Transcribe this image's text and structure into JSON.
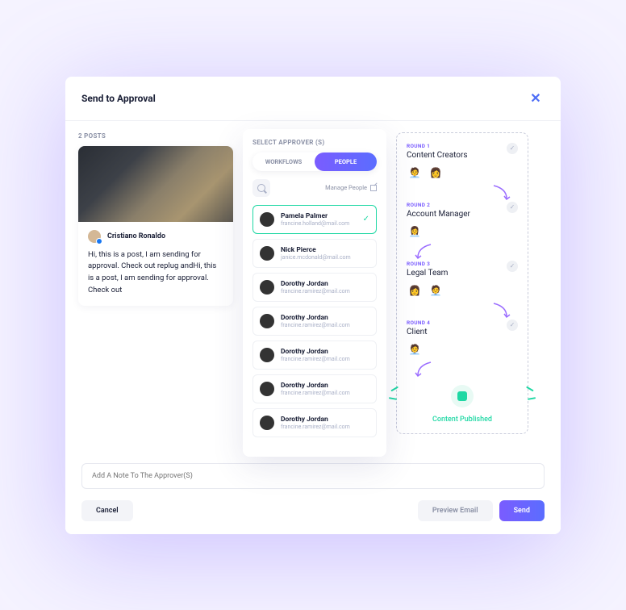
{
  "header": {
    "title": "Send to Approval"
  },
  "posts": {
    "count_label": "2 POSTS",
    "author": "Cristiano Ronaldo",
    "text": "Hi, this is a post, I am sending for approval. Check out replug andHi, this is a post, I am sending for approval. Check out"
  },
  "approvers": {
    "section_label": "SELECT APPROVER (s)",
    "tabs": {
      "workflows": "WORKFLOWS",
      "people": "PEOPLE"
    },
    "manage_label": "Manage People",
    "people": [
      {
        "name": "Pamela Palmer",
        "email": "francine.holland@mail.com",
        "selected": true
      },
      {
        "name": "Nick Pierce",
        "email": "janice.mcdonald@mail.com",
        "selected": false
      },
      {
        "name": "Dorothy Jordan",
        "email": "francine.ramirez@mail.com",
        "selected": false
      },
      {
        "name": "Dorothy Jordan",
        "email": "francine.ramirez@mail.com",
        "selected": false
      },
      {
        "name": "Dorothy Jordan",
        "email": "francine.ramirez@mail.com",
        "selected": false
      },
      {
        "name": "Dorothy Jordan",
        "email": "francine.ramirez@mail.com",
        "selected": false
      },
      {
        "name": "Dorothy Jordan",
        "email": "francine.ramirez@mail.com",
        "selected": false
      }
    ]
  },
  "flow": {
    "rounds": [
      {
        "label": "ROUND 1",
        "title": "Content Creators",
        "avatars": [
          "🧑‍💼",
          "👩"
        ]
      },
      {
        "label": "ROUND 2",
        "title": "Account Manager",
        "avatars": [
          "👩‍💼"
        ]
      },
      {
        "label": "ROUND 3",
        "title": "Legal Team",
        "avatars": [
          "👩",
          "🧑‍💼"
        ]
      },
      {
        "label": "ROUND 4",
        "title": "Client",
        "avatars": [
          "🧑‍💼"
        ]
      }
    ],
    "published_label": "Content Published"
  },
  "footer": {
    "note_placeholder": "Add A Note To The Approver(S)",
    "cancel": "Cancel",
    "preview": "Preview Email",
    "send": "Send"
  }
}
